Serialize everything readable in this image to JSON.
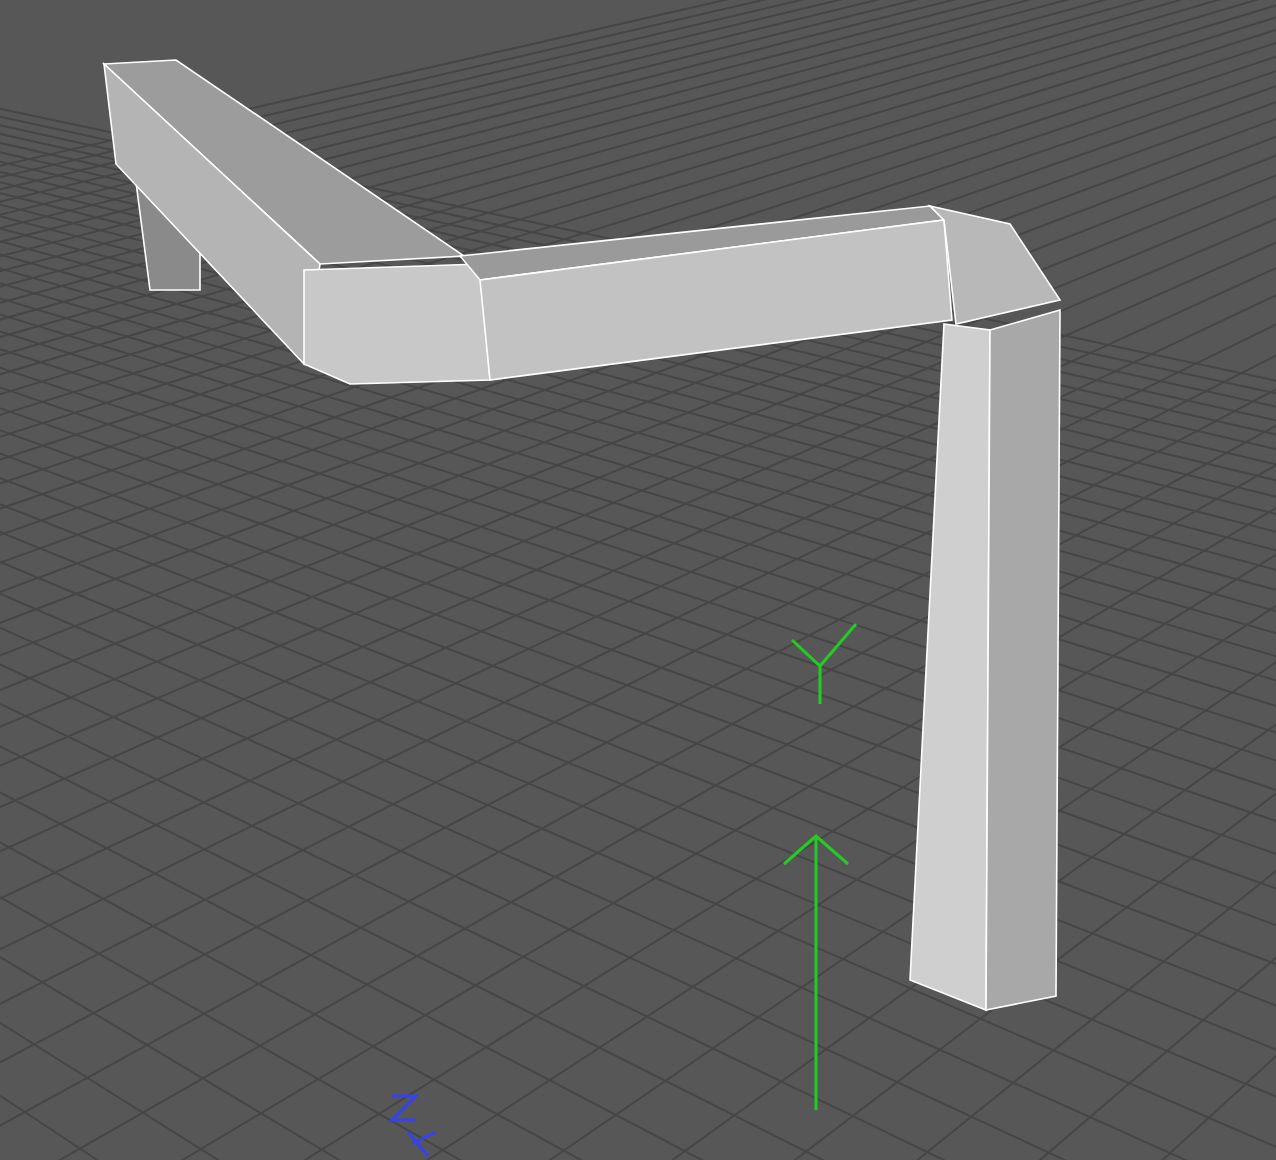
{
  "viewport": {
    "grid_visible": true,
    "object_selected": true
  }
}
